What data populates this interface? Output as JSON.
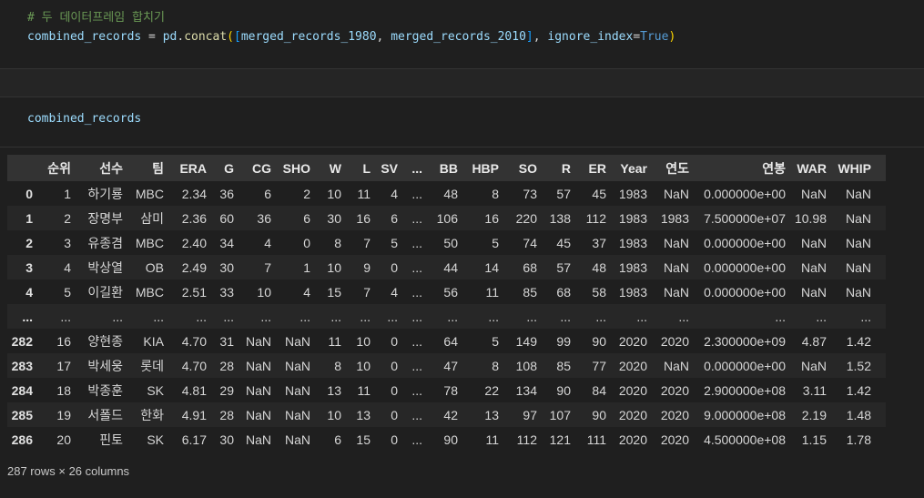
{
  "token_colors": {
    "comment": "#6A9955",
    "variable": "#9CDCFE",
    "function": "#DCDCAA",
    "plain": "#D4D4D4",
    "paren": "#FFD700",
    "bracket": "#179FFF",
    "keyword": "#569CD6"
  },
  "cells": {
    "cell1": {
      "lines": [
        [
          {
            "t": "# 두 데이터프레임 합치기",
            "c": "comment"
          }
        ],
        [
          {
            "t": "combined_records",
            "c": "variable"
          },
          {
            "t": " = ",
            "c": "plain"
          },
          {
            "t": "pd",
            "c": "variable"
          },
          {
            "t": ".",
            "c": "plain"
          },
          {
            "t": "concat",
            "c": "function"
          },
          {
            "t": "(",
            "c": "paren"
          },
          {
            "t": "[",
            "c": "bracket"
          },
          {
            "t": "merged_records_1980",
            "c": "variable"
          },
          {
            "t": ", ",
            "c": "plain"
          },
          {
            "t": "merged_records_2010",
            "c": "variable"
          },
          {
            "t": "]",
            "c": "bracket"
          },
          {
            "t": ", ",
            "c": "plain"
          },
          {
            "t": "ignore_index",
            "c": "variable"
          },
          {
            "t": "=",
            "c": "plain"
          },
          {
            "t": "True",
            "c": "keyword"
          },
          {
            "t": ")",
            "c": "paren"
          }
        ]
      ]
    },
    "cell2": {
      "lines": [
        [
          {
            "t": "combined_records",
            "c": "variable"
          }
        ]
      ]
    }
  },
  "table": {
    "columns": [
      "",
      "순위",
      "선수",
      "팀",
      "ERA",
      "G",
      "CG",
      "SHO",
      "W",
      "L",
      "SV",
      "...",
      "BB",
      "HBP",
      "SO",
      "R",
      "ER",
      "Year",
      "연도",
      "연봉",
      "WAR",
      "WHIP"
    ],
    "rows": [
      [
        "0",
        "1",
        "하기룡",
        "MBC",
        "2.34",
        "36",
        "6",
        "2",
        "10",
        "11",
        "4",
        "...",
        "48",
        "8",
        "73",
        "57",
        "45",
        "1983",
        "NaN",
        "0.000000e+00",
        "NaN",
        "NaN"
      ],
      [
        "1",
        "2",
        "장명부",
        "삼미",
        "2.36",
        "60",
        "36",
        "6",
        "30",
        "16",
        "6",
        "...",
        "106",
        "16",
        "220",
        "138",
        "112",
        "1983",
        "1983",
        "7.500000e+07",
        "10.98",
        "NaN"
      ],
      [
        "2",
        "3",
        "유종겸",
        "MBC",
        "2.40",
        "34",
        "4",
        "0",
        "8",
        "7",
        "5",
        "...",
        "50",
        "5",
        "74",
        "45",
        "37",
        "1983",
        "NaN",
        "0.000000e+00",
        "NaN",
        "NaN"
      ],
      [
        "3",
        "4",
        "박상열",
        "OB",
        "2.49",
        "30",
        "7",
        "1",
        "10",
        "9",
        "0",
        "...",
        "44",
        "14",
        "68",
        "57",
        "48",
        "1983",
        "NaN",
        "0.000000e+00",
        "NaN",
        "NaN"
      ],
      [
        "4",
        "5",
        "이길환",
        "MBC",
        "2.51",
        "33",
        "10",
        "4",
        "15",
        "7",
        "4",
        "...",
        "56",
        "11",
        "85",
        "68",
        "58",
        "1983",
        "NaN",
        "0.000000e+00",
        "NaN",
        "NaN"
      ],
      [
        "...",
        "...",
        "...",
        "...",
        "...",
        "...",
        "...",
        "...",
        "...",
        "...",
        "...",
        "...",
        "...",
        "...",
        "...",
        "...",
        "...",
        "...",
        "...",
        "...",
        "...",
        "..."
      ],
      [
        "282",
        "16",
        "양현종",
        "KIA",
        "4.70",
        "31",
        "NaN",
        "NaN",
        "11",
        "10",
        "0",
        "...",
        "64",
        "5",
        "149",
        "99",
        "90",
        "2020",
        "2020",
        "2.300000e+09",
        "4.87",
        "1.42"
      ],
      [
        "283",
        "17",
        "박세웅",
        "롯데",
        "4.70",
        "28",
        "NaN",
        "NaN",
        "8",
        "10",
        "0",
        "...",
        "47",
        "8",
        "108",
        "85",
        "77",
        "2020",
        "NaN",
        "0.000000e+00",
        "NaN",
        "1.52"
      ],
      [
        "284",
        "18",
        "박종훈",
        "SK",
        "4.81",
        "29",
        "NaN",
        "NaN",
        "13",
        "11",
        "0",
        "...",
        "78",
        "22",
        "134",
        "90",
        "84",
        "2020",
        "2020",
        "2.900000e+08",
        "3.11",
        "1.42"
      ],
      [
        "285",
        "19",
        "서폴드",
        "한화",
        "4.91",
        "28",
        "NaN",
        "NaN",
        "10",
        "13",
        "0",
        "...",
        "42",
        "13",
        "97",
        "107",
        "90",
        "2020",
        "2020",
        "9.000000e+08",
        "2.19",
        "1.48"
      ],
      [
        "286",
        "20",
        "핀토",
        "SK",
        "6.17",
        "30",
        "NaN",
        "NaN",
        "6",
        "15",
        "0",
        "...",
        "90",
        "11",
        "112",
        "121",
        "111",
        "2020",
        "2020",
        "4.500000e+08",
        "1.15",
        "1.78"
      ]
    ],
    "footer": "287 rows × 26 columns"
  }
}
